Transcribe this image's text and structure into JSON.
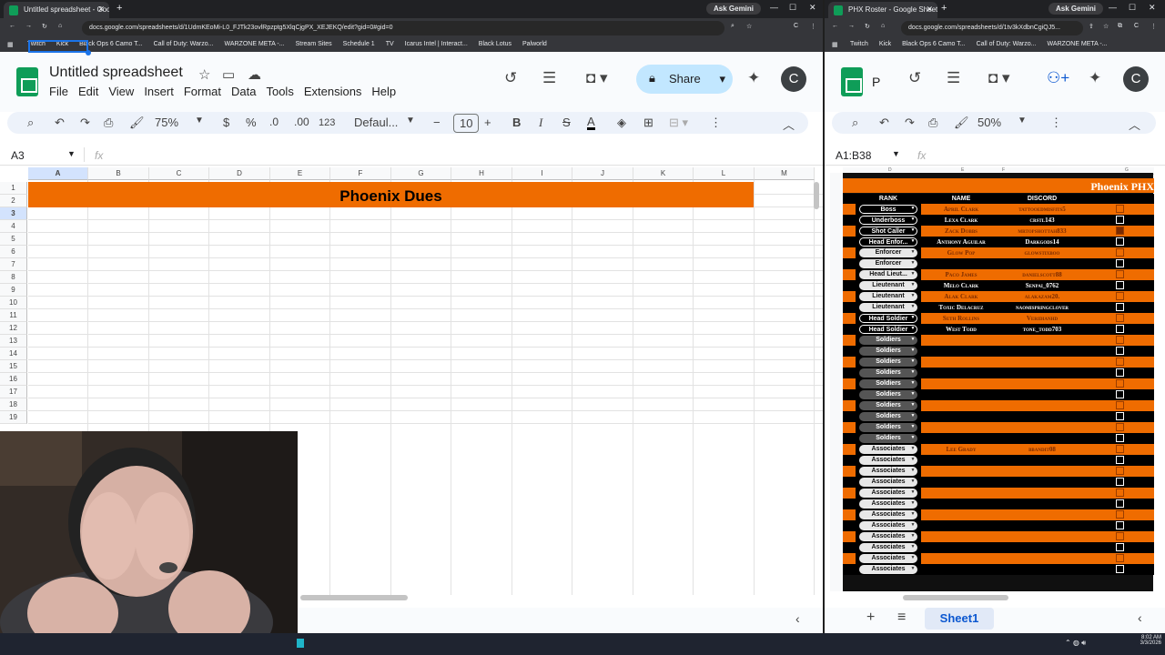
{
  "left_window": {
    "tab_title": "Untitled spreadsheet - Google ...",
    "gemini": "Ask Gemini",
    "url": "docs.google.com/spreadsheets/d/1UdmKEoMi-L0_FJTk23ovlRpzptg5XlqCjgPX_XEJEKQ/edit?gid=0#gid=0",
    "bookmarks": [
      "Twitch",
      "Kick",
      "Black Ops 6 Camo T...",
      "Call of Duty: Warzo...",
      "WARZONE META -...",
      "Stream Sites",
      "Schedule 1",
      "TV",
      "Icarus Intel | Interact...",
      "Black Lotus",
      "Palworld"
    ],
    "doc_title": "Untitled spreadsheet",
    "menu": [
      "File",
      "Edit",
      "View",
      "Insert",
      "Format",
      "Data",
      "Tools",
      "Extensions",
      "Help"
    ],
    "share": "Share",
    "avatar": "C",
    "zoom": "75%",
    "currency": "$",
    "percent": "%",
    "dec_less": ".0",
    "dec_more": ".00",
    "num_fmt": "123",
    "font": "Defaul...",
    "font_size": "10",
    "bold": "B",
    "italic": "I",
    "strike": "S",
    "text_color": "A",
    "cell_ref": "A3",
    "fx": "fx",
    "columns": [
      "A",
      "B",
      "C",
      "D",
      "E",
      "F",
      "G",
      "H",
      "I",
      "J",
      "K",
      "L",
      "M"
    ],
    "rows": [
      "1",
      "2",
      "3",
      "4",
      "5",
      "6",
      "7",
      "8",
      "9",
      "10",
      "11",
      "12",
      "13",
      "14",
      "15",
      "16",
      "17",
      "18",
      "19"
    ],
    "banner_text": "Phoenix Dues"
  },
  "right_window": {
    "tab_title": "PHX Roster - Google Sheets",
    "gemini": "Ask Gemini",
    "url": "docs.google.com/spreadsheets/d/1tv3kXdbnCgiQJ5...",
    "bookmarks": [
      "Twitch",
      "Kick",
      "Black Ops 6 Camo T...",
      "Call of Duty: Warzo...",
      "WARZONE META -..."
    ],
    "doc_title_short": "P",
    "avatar": "C",
    "zoom": "50%",
    "cell_ref": "A1:B38",
    "fx": "fx",
    "columns": [
      "D",
      "E",
      "F",
      "G"
    ],
    "title": "Phoenix PHX",
    "headers": {
      "rank": "RANK",
      "name": "NAME",
      "discord": "DISCORD"
    },
    "roster": [
      {
        "rank": "Boss",
        "name": "April Clark",
        "discord": "tattooedmisfits5",
        "checked": false
      },
      {
        "rank": "Underboss",
        "name": "Lexa Clark",
        "discord": "crstl143",
        "checked": false
      },
      {
        "rank": "Shot Caller",
        "name": "Zack Dobbs",
        "discord": "mrtopshottah833",
        "checked": true
      },
      {
        "rank": "Head Enfor...",
        "name": "Anthony Aguilar",
        "discord": "Darkgods14",
        "checked": false
      },
      {
        "rank": "Enforcer",
        "name": "Glow Pop",
        "discord": "glowstixboo",
        "checked": false
      },
      {
        "rank": "Enforcer",
        "name": "",
        "discord": "",
        "checked": false
      },
      {
        "rank": "Head Lieut...",
        "name": "Paco James",
        "discord": "danielscott88",
        "checked": false
      },
      {
        "rank": "Lieutenant",
        "name": "Melo Clark",
        "discord": "Senpai_0762",
        "checked": false
      },
      {
        "rank": "Lieutenant",
        "name": "Alak Clark",
        "discord": "alakazam20.",
        "checked": false
      },
      {
        "rank": "Lieutenant",
        "name": "Toxic Delacruz",
        "discord": "naomispringclover",
        "checked": false
      },
      {
        "rank": "Head Soldier",
        "name": "Seth Rollins",
        "discord": "Veridianhd",
        "checked": false
      },
      {
        "rank": "Head Soldier",
        "name": "West Todd",
        "discord": "tone_todd703",
        "checked": false
      },
      {
        "rank": "Soldiers",
        "name": "",
        "discord": "",
        "checked": false
      },
      {
        "rank": "Soldiers",
        "name": "",
        "discord": "",
        "checked": false
      },
      {
        "rank": "Soldiers",
        "name": "",
        "discord": "",
        "checked": false
      },
      {
        "rank": "Soldiers",
        "name": "",
        "discord": "",
        "checked": false
      },
      {
        "rank": "Soldiers",
        "name": "",
        "discord": "",
        "checked": false
      },
      {
        "rank": "Soldiers",
        "name": "",
        "discord": "",
        "checked": false
      },
      {
        "rank": "Soldiers",
        "name": "",
        "discord": "",
        "checked": false
      },
      {
        "rank": "Soldiers",
        "name": "",
        "discord": "",
        "checked": false
      },
      {
        "rank": "Soldiers",
        "name": "",
        "discord": "",
        "checked": false
      },
      {
        "rank": "Soldiers",
        "name": "",
        "discord": "",
        "checked": false
      },
      {
        "rank": "Associates",
        "name": "Lee Grady",
        "discord": "bbandit08",
        "checked": false
      },
      {
        "rank": "Associates",
        "name": "",
        "discord": "",
        "checked": false
      },
      {
        "rank": "Associates",
        "name": "",
        "discord": "",
        "checked": false
      },
      {
        "rank": "Associates",
        "name": "",
        "discord": "",
        "checked": false
      },
      {
        "rank": "Associates",
        "name": "",
        "discord": "",
        "checked": false
      },
      {
        "rank": "Associates",
        "name": "",
        "discord": "",
        "checked": false
      },
      {
        "rank": "Associates",
        "name": "",
        "discord": "",
        "checked": false
      },
      {
        "rank": "Associates",
        "name": "",
        "discord": "",
        "checked": false
      },
      {
        "rank": "Associates",
        "name": "",
        "discord": "",
        "checked": false
      },
      {
        "rank": "Associates",
        "name": "",
        "discord": "",
        "checked": false
      },
      {
        "rank": "Associates",
        "name": "",
        "discord": "",
        "checked": false
      },
      {
        "rank": "Associates",
        "name": "",
        "discord": "",
        "checked": false
      }
    ],
    "sheet_tab": "Sheet1"
  },
  "taskbar": {
    "time": "8:02 AM",
    "date": "3/3/2026"
  },
  "colors": {
    "orange": "#ef6c00",
    "black": "#000000",
    "accent_blue": "#1a73e8",
    "share_bg": "#c2e7ff"
  }
}
